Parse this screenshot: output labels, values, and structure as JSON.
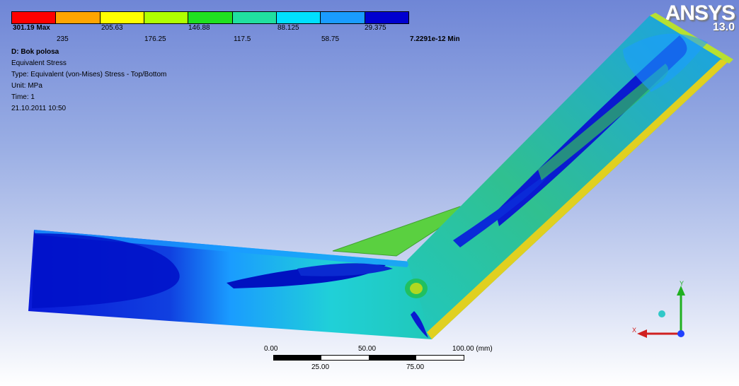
{
  "legend": {
    "colors": [
      "#ff0000",
      "#ffa500",
      "#ffff00",
      "#b0ff00",
      "#20e020",
      "#20e0a0",
      "#00e0ff",
      "#1a9cff",
      "#0000d0"
    ],
    "top_labels": [
      "301.19 Max",
      "205.63",
      "146.88",
      "88.125",
      "29.375"
    ],
    "bottom_labels": [
      "235",
      "176.25",
      "117.5",
      "58.75",
      "7.2291e-12 Min"
    ]
  },
  "info": {
    "title": "D: Bok polosa",
    "result": "Equivalent Stress",
    "type": "Type: Equivalent (von-Mises) Stress - Top/Bottom",
    "unit": "Unit: MPa",
    "time": "Time: 1",
    "date": "21.10.2011 10:50"
  },
  "logo": {
    "text": "ANSYS",
    "version": "13.0"
  },
  "scale": {
    "top_ticks": [
      "0.00",
      "50.00",
      "100.00 (mm)"
    ],
    "bottom_ticks": [
      "25.00",
      "75.00"
    ]
  },
  "triad": {
    "x_label": "X",
    "y_label": "Y"
  }
}
